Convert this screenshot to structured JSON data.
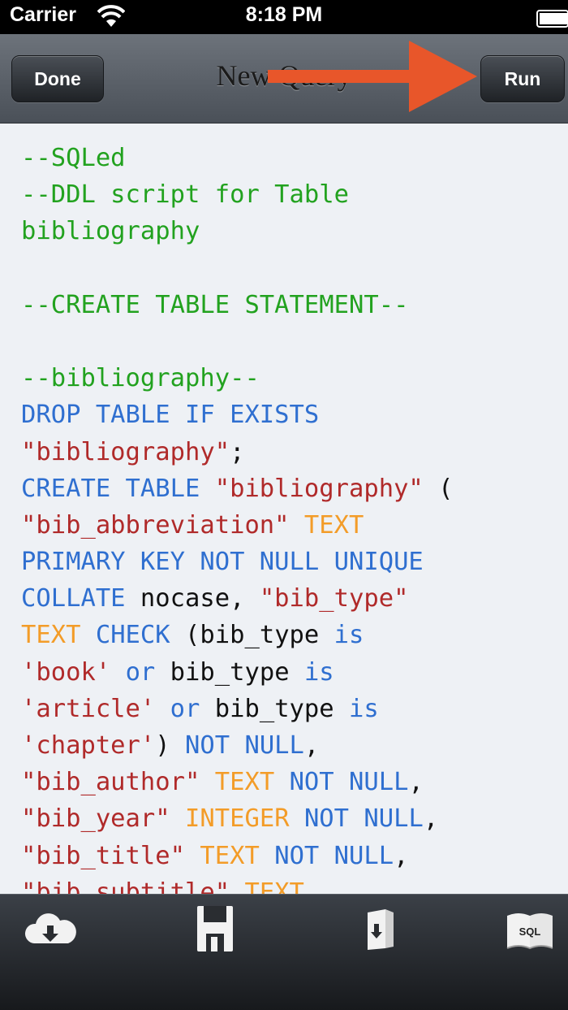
{
  "status_bar": {
    "carrier": "Carrier",
    "time": "8:18 PM"
  },
  "nav": {
    "done_label": "Done",
    "title": "New Query",
    "run_label": "Run"
  },
  "annotation": {
    "arrow_color": "#e8562a"
  },
  "colors": {
    "comment": "#22a21f",
    "keyword": "#2f6fd0",
    "string": "#b02a2a",
    "type": "#f39c28",
    "plain": "#111111"
  },
  "editor": {
    "lines": [
      [
        {
          "t": "--SQLed",
          "c": "comment"
        }
      ],
      [
        {
          "t": "--DDL script for Table",
          "c": "comment"
        }
      ],
      [
        {
          "t": "bibliography",
          "c": "comment"
        }
      ],
      [],
      [
        {
          "t": "--CREATE TABLE STATEMENT--",
          "c": "comment"
        }
      ],
      [],
      [
        {
          "t": "--bibliography--",
          "c": "comment"
        }
      ],
      [
        {
          "t": "DROP TABLE IF EXISTS",
          "c": "keyword"
        }
      ],
      [
        {
          "t": "\"bibliography\"",
          "c": "string"
        },
        {
          "t": ";",
          "c": "plain"
        }
      ],
      [
        {
          "t": "CREATE TABLE ",
          "c": "keyword"
        },
        {
          "t": "\"bibliography\"",
          "c": "string"
        },
        {
          "t": " (",
          "c": "plain"
        }
      ],
      [
        {
          "t": "\"bib_abbreviation\"",
          "c": "string"
        },
        {
          "t": " ",
          "c": "plain"
        },
        {
          "t": "TEXT",
          "c": "type"
        }
      ],
      [
        {
          "t": "PRIMARY KEY NOT NULL UNIQUE",
          "c": "keyword"
        }
      ],
      [
        {
          "t": "COLLATE",
          "c": "keyword"
        },
        {
          "t": " nocase, ",
          "c": "plain"
        },
        {
          "t": "\"bib_type\"",
          "c": "string"
        }
      ],
      [
        {
          "t": "TEXT",
          "c": "type"
        },
        {
          "t": " ",
          "c": "plain"
        },
        {
          "t": "CHECK",
          "c": "keyword"
        },
        {
          "t": " (bib_type ",
          "c": "plain"
        },
        {
          "t": "is",
          "c": "keyword"
        }
      ],
      [
        {
          "t": "'book'",
          "c": "string"
        },
        {
          "t": " ",
          "c": "plain"
        },
        {
          "t": "or",
          "c": "keyword"
        },
        {
          "t": " bib_type ",
          "c": "plain"
        },
        {
          "t": "is",
          "c": "keyword"
        }
      ],
      [
        {
          "t": "'article'",
          "c": "string"
        },
        {
          "t": " ",
          "c": "plain"
        },
        {
          "t": "or",
          "c": "keyword"
        },
        {
          "t": " bib_type ",
          "c": "plain"
        },
        {
          "t": "is",
          "c": "keyword"
        }
      ],
      [
        {
          "t": "'chapter'",
          "c": "string"
        },
        {
          "t": ") ",
          "c": "plain"
        },
        {
          "t": "NOT NULL",
          "c": "keyword"
        },
        {
          "t": ",",
          "c": "plain"
        }
      ],
      [
        {
          "t": "\"bib_author\"",
          "c": "string"
        },
        {
          "t": " ",
          "c": "plain"
        },
        {
          "t": "TEXT",
          "c": "type"
        },
        {
          "t": " ",
          "c": "plain"
        },
        {
          "t": "NOT NULL",
          "c": "keyword"
        },
        {
          "t": ",",
          "c": "plain"
        }
      ],
      [
        {
          "t": "\"bib_year\"",
          "c": "string"
        },
        {
          "t": " ",
          "c": "plain"
        },
        {
          "t": "INTEGER",
          "c": "type"
        },
        {
          "t": " ",
          "c": "plain"
        },
        {
          "t": "NOT NULL",
          "c": "keyword"
        },
        {
          "t": ",",
          "c": "plain"
        }
      ],
      [
        {
          "t": "\"bib_title\"",
          "c": "string"
        },
        {
          "t": " ",
          "c": "plain"
        },
        {
          "t": "TEXT",
          "c": "type"
        },
        {
          "t": " ",
          "c": "plain"
        },
        {
          "t": "NOT NULL",
          "c": "keyword"
        },
        {
          "t": ",",
          "c": "plain"
        }
      ],
      [
        {
          "t": "\"bib_subtitle\"",
          "c": "string"
        },
        {
          "t": " ",
          "c": "plain"
        },
        {
          "t": "TEXT",
          "c": "type"
        }
      ]
    ]
  },
  "toolbar": {
    "items": [
      {
        "name": "cloud-download-icon"
      },
      {
        "name": "save-icon"
      },
      {
        "name": "import-icon"
      },
      {
        "name": "sql-book-icon",
        "label": "SQL"
      }
    ]
  }
}
